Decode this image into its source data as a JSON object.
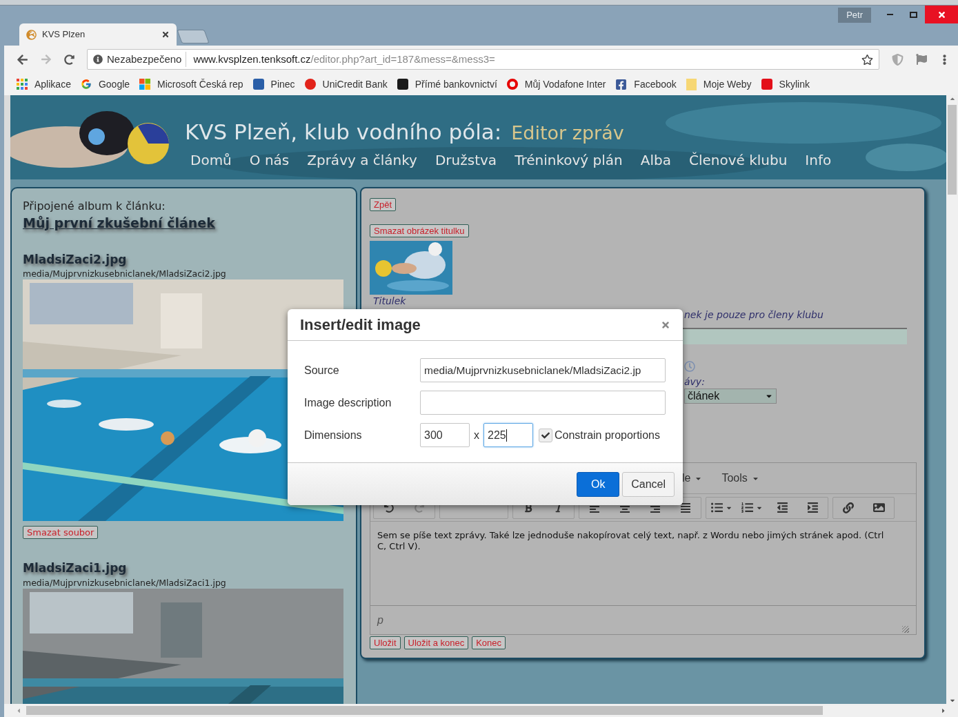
{
  "browser": {
    "user": "Petr",
    "tab": {
      "title": "KVS Plzen"
    },
    "address": {
      "security": "Nezabezpečeno",
      "host": "www.kvsplzen.tenksoft.cz",
      "path": "/editor.php?art_id=187&mess=&mess3="
    },
    "bookmarks": [
      {
        "label": "Aplikace",
        "kind": "apps"
      },
      {
        "label": "Google",
        "kind": "google"
      },
      {
        "label": "Microsoft Česká rep",
        "kind": "windows"
      },
      {
        "label": "Pinec",
        "kind": "square",
        "color": "#2b5fa8"
      },
      {
        "label": "UniCredit Bank",
        "kind": "circle",
        "color": "#e2231a"
      },
      {
        "label": "Přímé bankovnictví",
        "kind": "square",
        "color": "#1a1a1a"
      },
      {
        "label": "Můj Vodafone Inter",
        "kind": "ring",
        "color": "#e60000"
      },
      {
        "label": "Facebook",
        "kind": "facebook"
      },
      {
        "label": "Moje Weby",
        "kind": "folder",
        "color": "#f7d774"
      },
      {
        "label": "Skylink",
        "kind": "square",
        "color": "#e3101a"
      }
    ]
  },
  "site": {
    "title": "KVS Plzeň, klub vodního póla:",
    "subtitle": "Editor zpráv",
    "nav": [
      "Domů",
      "O nás",
      "Zprávy a články",
      "Družstva",
      "Tréninkový plán",
      "Alba",
      "Členové klubu",
      "Info"
    ]
  },
  "album": {
    "heading": "Připojené album k článku:",
    "article": "Můj první zkušební článek",
    "files": [
      {
        "name": "MladsiZaci2.jpg",
        "path": "media/Mujprvnizkusebniclanek/MladsiZaci2.jpg",
        "button": "Smazat soubor"
      },
      {
        "name": "MladsiZaci1.jpg",
        "path": "media/Mujprvnizkusebniclanek/MladsiZaci1.jpg"
      }
    ]
  },
  "editor": {
    "back": "Zpět",
    "delete_title_image": "Smazat obrázek titulku",
    "caption": "Titulek",
    "members_note": "nek je pouze pro členy klubu",
    "type_label": "ávy:",
    "type_value": "článek",
    "menu": [
      "le",
      "Tools"
    ],
    "body": "Sem se píše text zprávy. Také lze jednoduše nakopírovat celý text, např. z Wordu nebo jimých stránek apod. (Ctrl C, Ctrl V).",
    "path": "p",
    "buttons": [
      "Uložit",
      "Uložit a konec",
      "Konec"
    ]
  },
  "dialog": {
    "title": "Insert/edit image",
    "source": {
      "label": "Source",
      "value": "media/Mujprvnizkusebniclanek/MladsiZaci2.jp"
    },
    "description": {
      "label": "Image description"
    },
    "dimensions": {
      "label": "Dimensions",
      "separator": "x",
      "fields": [
        {
          "value": "300",
          "focused": false
        },
        {
          "value": "225",
          "focused": true
        }
      ]
    },
    "constrain": {
      "label": "Constrain proportions",
      "checked": true
    },
    "buttons": [
      {
        "label": "Ok",
        "primary": true
      },
      {
        "label": "Cancel",
        "primary": false
      }
    ]
  }
}
